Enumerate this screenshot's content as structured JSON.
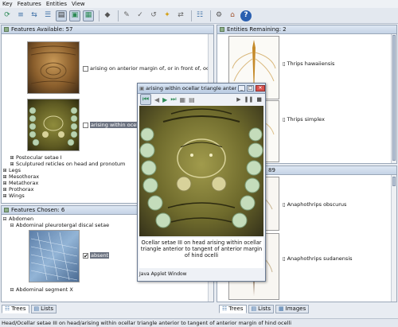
{
  "menu": [
    "Key",
    "Features",
    "Entities",
    "View"
  ],
  "toolbar_icons": [
    "refresh-icon",
    "find-icon",
    "restart-icon",
    "compare-icon",
    "tree-view-icon",
    "image-view-icon",
    "image-grid-icon",
    "tag-icon",
    "pointer-icon",
    "checkmark-icon",
    "reset-icon",
    "star-icon",
    "list-icon",
    "filter-icon",
    "home-icon",
    "help-icon"
  ],
  "features_available": {
    "title": "Features Available: 57",
    "item1": "arising on anterior margin of, or in front of, ocellar t",
    "item2": "arising within ocella",
    "item3": "Postocular setae I",
    "item4": "Sculptured reticles on head and pronotum",
    "groups": [
      "Legs",
      "Mesothorax",
      "Metathorax",
      "Prothorax",
      "Wings"
    ]
  },
  "features_chosen": {
    "title": "Features Chosen: 6",
    "g1": "Abdomen",
    "g2": "Abdominal pleurotergal discal setae",
    "choice": "absent",
    "g3": "Abdominal segment X"
  },
  "entities_remaining": {
    "title": "Entities Remaining: 2",
    "items": [
      "Thrips hawaiiensis",
      "Thrips simplex"
    ]
  },
  "entities_discarded": {
    "title_suffix": "89",
    "items": [
      "Anaphothrips obscurus",
      "Anaphothrips sudanensis"
    ]
  },
  "left_tabs": [
    "Trees",
    "Lists"
  ],
  "right_tabs": [
    "Trees",
    "Lists",
    "Images"
  ],
  "status": "Head/Ocellar setae III on head/arising within ocellar triangle anterior to tangent of anterior margin of hind ocelli",
  "popup": {
    "title": "arising within ocellar triangle anterior to ta...",
    "caption": "Ocellar setae III on head arising within ocellar triangle anterior to tangent of anterior margin of hind ocelli",
    "applet": "Java Applet Window"
  }
}
